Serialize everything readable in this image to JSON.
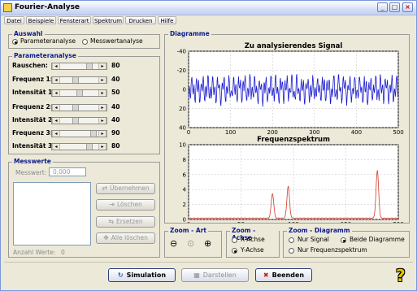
{
  "window": {
    "title": "Fourier-Analyse"
  },
  "menu": [
    "Datei",
    "Beispiele",
    "Fensterart",
    "Spektrum",
    "Drucken",
    "Hilfe"
  ],
  "auswahl": {
    "title": "Auswahl",
    "options": [
      "Parameteranalyse",
      "Messwertanalyse"
    ],
    "selected": "Parameteranalyse"
  },
  "parameter": {
    "title": "Parameteranalyse",
    "rows": [
      {
        "label": "Rauschen:",
        "value": "80",
        "level": 0.8
      },
      {
        "label": "Frequenz 1:",
        "value": "40",
        "level": 0.4
      },
      {
        "label": "Intensität 1:",
        "value": "50",
        "level": 0.5
      },
      {
        "label": "Frequenz 2:",
        "value": "40",
        "level": 0.4
      },
      {
        "label": "Intensität 2:",
        "value": "40",
        "level": 0.4
      },
      {
        "label": "Frequenz 3:",
        "value": "90",
        "level": 0.9
      },
      {
        "label": "Intensität 3:",
        "value": "80",
        "level": 0.8
      }
    ]
  },
  "messwerte": {
    "title": "Messwerte",
    "input_label": "Messwert:",
    "input_value": "0,000",
    "buttons": [
      "Übernehmen",
      "Löschen",
      "Ersetzen",
      "Alle löschen"
    ],
    "count_label": "Anzahl Werte:",
    "count_value": "0"
  },
  "diagramme": {
    "title": "Diagramme"
  },
  "zoom_art": {
    "title": "Zoom - Art"
  },
  "zoom_achse": {
    "title": "Zoom - Achse",
    "options": [
      "X-Achse",
      "Y-Achse"
    ],
    "selected": "Y-Achse"
  },
  "zoom_diagramm": {
    "title": "Zoom - Diagramm",
    "options": [
      "Nur Signal",
      "Beide Diagramme",
      "Nur Frequenzspektrum"
    ],
    "selected": "Beide Diagramme"
  },
  "bottom_buttons": [
    "Simulation",
    "Darstellen",
    "Beenden"
  ],
  "colors": {
    "signal": "#1a1ad0",
    "spectrum": "#d23a2a",
    "group_title": "#0b1a8c"
  },
  "chart_data": [
    {
      "type": "line",
      "title": "Zu analysierendes Signal",
      "xlim": [
        0,
        500
      ],
      "ylim": [
        -40,
        40
      ],
      "y_reversed": true,
      "xticks": [
        "0",
        "100",
        "200",
        "300",
        "400",
        "500"
      ],
      "yticks": [
        "-40",
        "-20",
        "0",
        "20",
        "40"
      ],
      "series": [
        {
          "note_only": false,
          "freqs": [
            40,
            40,
            90
          ],
          "amps": [
            5.0,
            4.0,
            8.0
          ],
          "noise": 3.0,
          "n": 500
        }
      ]
    },
    {
      "type": "line",
      "title": "Frequenzspektrum",
      "xlim": [
        0,
        200
      ],
      "ylim": [
        0,
        10
      ],
      "xticks": [
        "0",
        "50",
        "100",
        "150",
        "200"
      ],
      "yticks": [
        "0",
        "2",
        "4",
        "6",
        "8",
        "10"
      ],
      "series": [
        {
          "peaks": [
            {
              "x": 80,
              "y": 3.3
            },
            {
              "x": 95,
              "y": 4.3
            },
            {
              "x": 180,
              "y": 6.4
            }
          ],
          "baseline": 0.15
        }
      ]
    }
  ]
}
